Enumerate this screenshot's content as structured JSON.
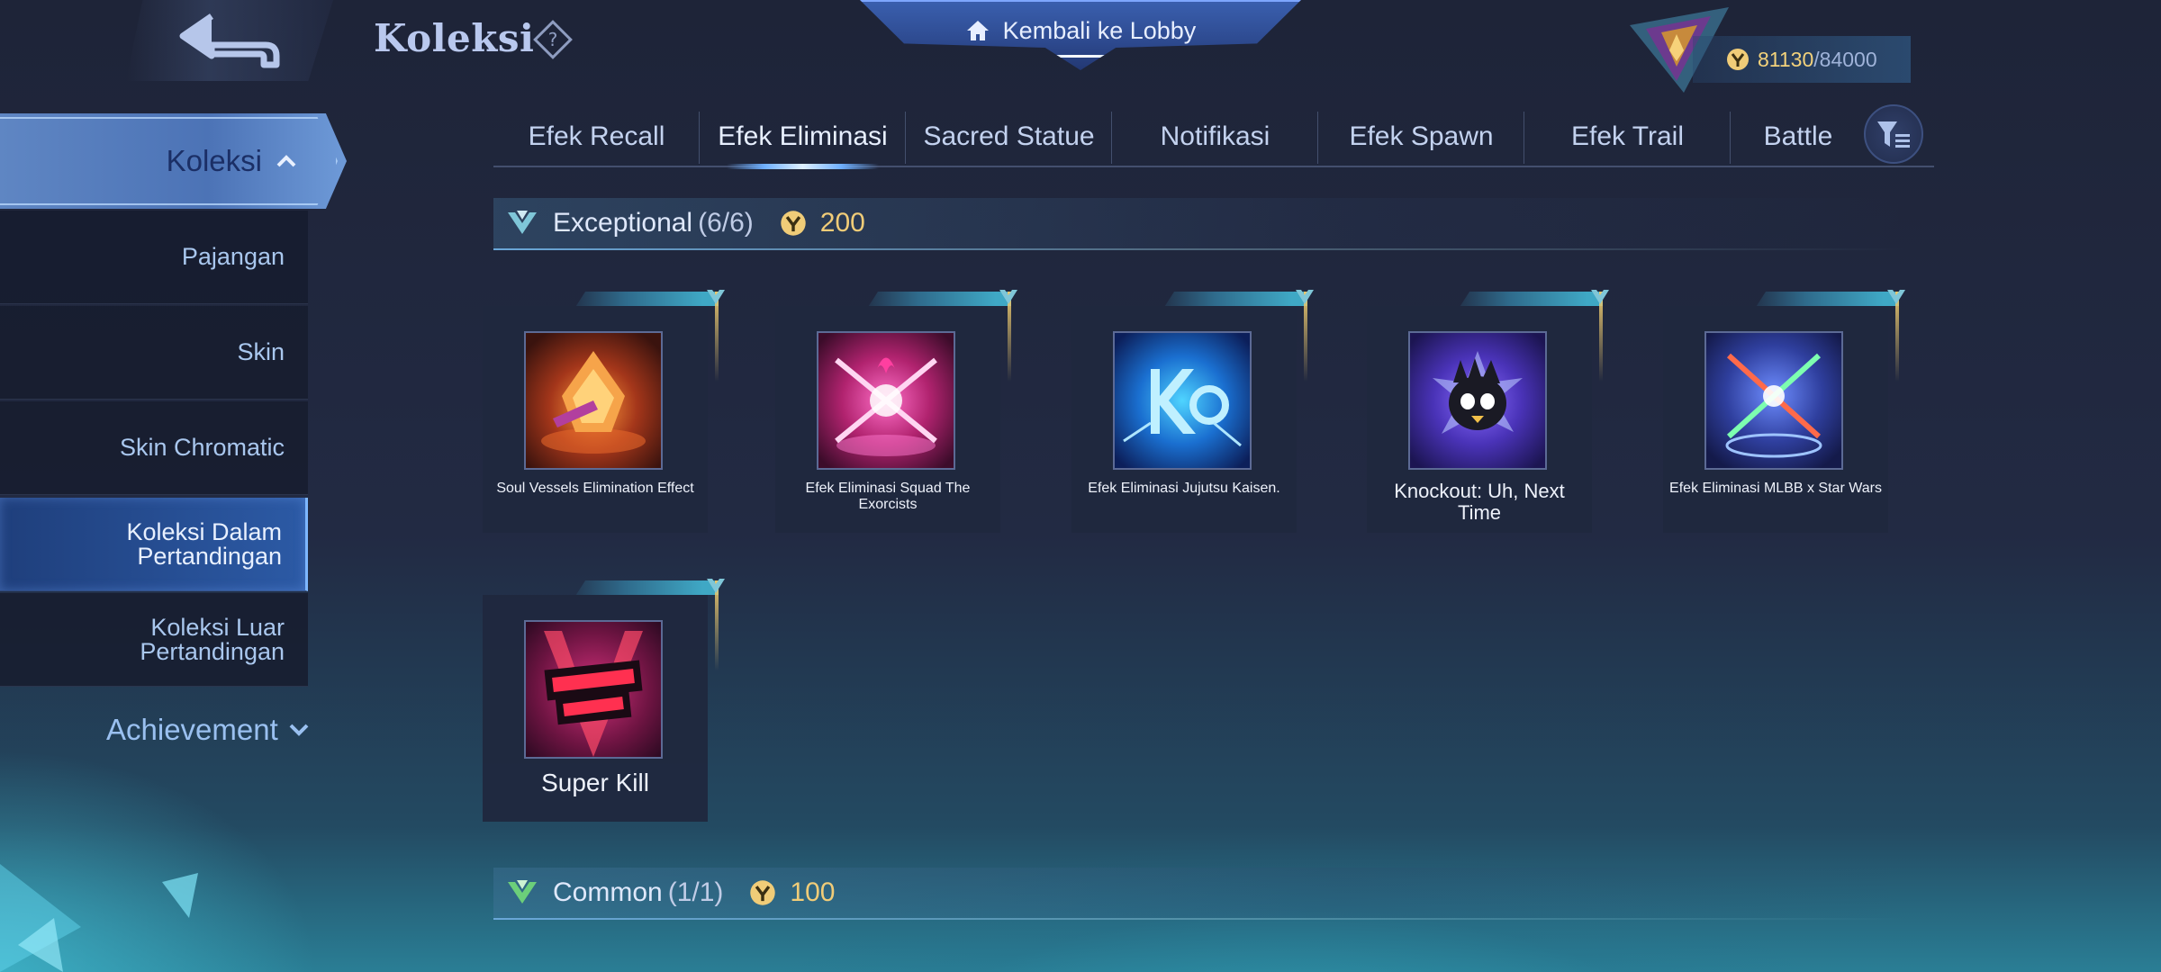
{
  "header": {
    "title": "Koleksi",
    "lobby_label": "Kembali ke Lobby",
    "points_current": "81130",
    "points_max": "/84000"
  },
  "sidebar": {
    "koleksi_label": "Koleksi",
    "items": [
      {
        "label": "Pajangan"
      },
      {
        "label": "Skin"
      },
      {
        "label": "Skin Chromatic"
      },
      {
        "label": "Koleksi Dalam Pertandingan"
      },
      {
        "label": "Koleksi Luar Pertandingan"
      }
    ],
    "achievement_label": "Achievement"
  },
  "tabs": [
    {
      "label": "Efek Recall"
    },
    {
      "label": "Efek Eliminasi"
    },
    {
      "label": "Sacred Statue"
    },
    {
      "label": "Notifikasi"
    },
    {
      "label": "Efek Spawn"
    },
    {
      "label": "Efek Trail"
    },
    {
      "label": "Battle"
    }
  ],
  "sections": [
    {
      "title": "Exceptional",
      "count": "(6/6)",
      "cost": "200",
      "items": [
        {
          "name": "Soul Vessels Elimination Effect"
        },
        {
          "name": "Efek Eliminasi Squad The Exorcists"
        },
        {
          "name": "Efek Eliminasi Jujutsu Kaisen."
        },
        {
          "name": "Knockout: Uh, Next Time"
        },
        {
          "name": "Efek Eliminasi MLBB x Star Wars"
        },
        {
          "name": "Super Kill"
        }
      ]
    },
    {
      "title": "Common",
      "count": "(1/1)",
      "cost": "100"
    }
  ],
  "icons": {
    "back": "back-arrow-icon",
    "help": "help-icon",
    "home": "home-icon",
    "filter": "filter-icon",
    "coin": "coin-icon"
  },
  "colors": {
    "accent_gold": "#f0cc78",
    "tab_active": "#6fb0ff",
    "sidebar_active": "#2c5aa5"
  }
}
